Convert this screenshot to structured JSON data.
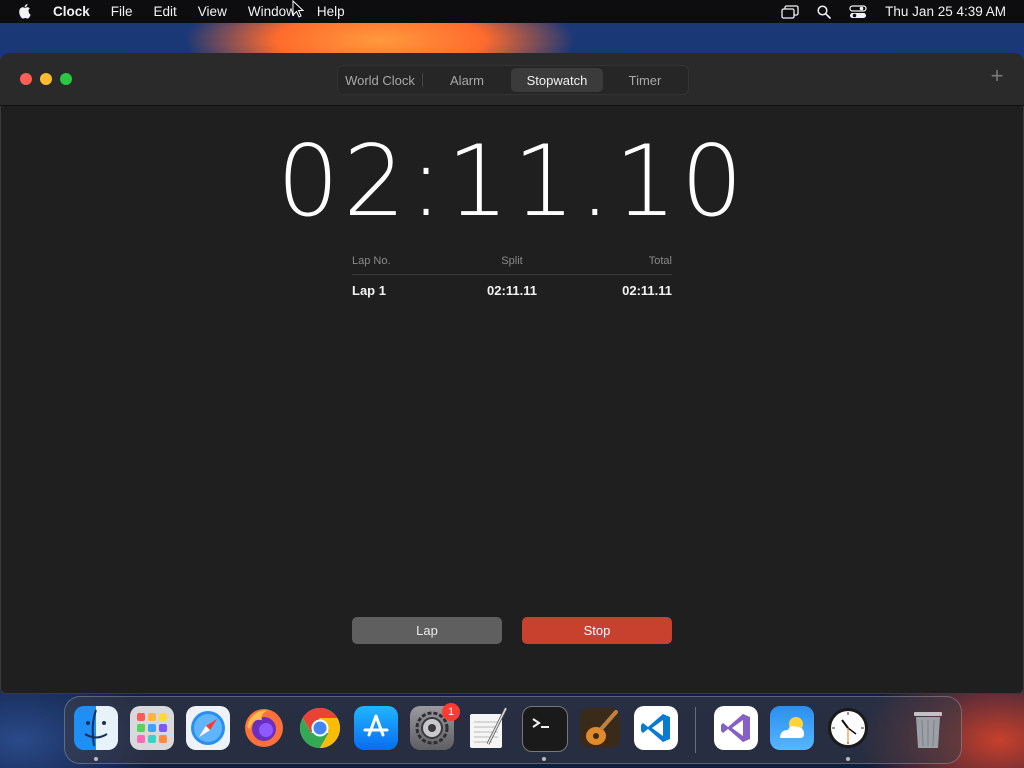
{
  "menubar": {
    "app_name": "Clock",
    "menus": [
      "File",
      "Edit",
      "View",
      "Window",
      "Help"
    ],
    "datetime": "Thu Jan 25  4:39 AM"
  },
  "window": {
    "tabs": [
      {
        "label": "World Clock",
        "active": false
      },
      {
        "label": "Alarm",
        "active": false
      },
      {
        "label": "Stopwatch",
        "active": true
      },
      {
        "label": "Timer",
        "active": false
      }
    ],
    "add_label": "+"
  },
  "stopwatch": {
    "time": "02:11.10",
    "columns": {
      "lap": "Lap No.",
      "split": "Split",
      "total": "Total"
    },
    "laps": [
      {
        "lap": "Lap 1",
        "split": "02:11.11",
        "total": "02:11.11"
      }
    ],
    "lap_button": "Lap",
    "stop_button": "Stop"
  },
  "dock": {
    "apps": [
      {
        "name": "finder-icon"
      },
      {
        "name": "launchpad-icon"
      },
      {
        "name": "safari-icon"
      },
      {
        "name": "firefox-icon"
      },
      {
        "name": "chrome-icon"
      },
      {
        "name": "app-store-icon"
      },
      {
        "name": "system-settings-icon",
        "badge": "1"
      },
      {
        "name": "textedit-icon"
      },
      {
        "name": "terminal-icon"
      },
      {
        "name": "garageband-icon"
      },
      {
        "name": "vscode-icon"
      },
      {
        "name": "visual-studio-icon"
      },
      {
        "name": "weather-icon"
      },
      {
        "name": "clock-icon"
      },
      {
        "name": "trash-icon"
      }
    ]
  },
  "colors": {
    "stop": "#c7412e",
    "lap": "#5f5f5f",
    "window_bg": "#1f1f1f"
  }
}
